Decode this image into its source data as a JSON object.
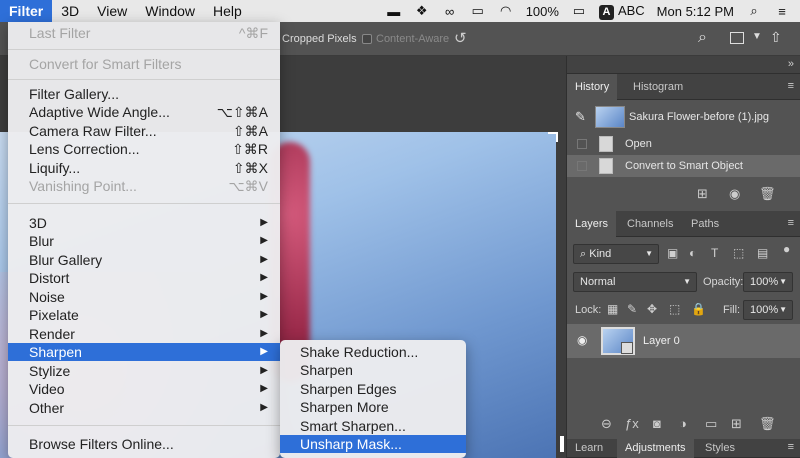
{
  "menubar": {
    "items": [
      "Filter",
      "3D",
      "View",
      "Window",
      "Help"
    ],
    "active_index": 0,
    "battery": "100%",
    "input_source": "ABC",
    "input_badge": "A",
    "clock": "Mon 5:12 PM",
    "status_icons": [
      "dropbox-icon",
      "creative-cloud-icon",
      "airplay-icon",
      "wifi-icon",
      "battery-icon",
      "search-icon",
      "control-center-icon"
    ]
  },
  "optionsbar": {
    "cropped_pixels": "Cropped Pixels",
    "content_aware": "Content-Aware"
  },
  "filter_menu": {
    "last_filter": {
      "label": "Last Filter",
      "shortcut": "^⌘F",
      "disabled": true
    },
    "convert_smart": {
      "label": "Convert for Smart Filters",
      "disabled": true
    },
    "group1": [
      {
        "label": "Filter Gallery...",
        "shortcut": ""
      },
      {
        "label": "Adaptive Wide Angle...",
        "shortcut": "⌥⇧⌘A"
      },
      {
        "label": "Camera Raw Filter...",
        "shortcut": "⇧⌘A"
      },
      {
        "label": "Lens Correction...",
        "shortcut": "⇧⌘R"
      },
      {
        "label": "Liquify...",
        "shortcut": "⇧⌘X"
      },
      {
        "label": "Vanishing Point...",
        "shortcut": "⌥⌘V",
        "disabled": true
      }
    ],
    "group2": [
      "3D",
      "Blur",
      "Blur Gallery",
      "Distort",
      "Noise",
      "Pixelate",
      "Render",
      "Sharpen",
      "Stylize",
      "Video",
      "Other"
    ],
    "highlighted": "Sharpen",
    "browse": "Browse Filters Online..."
  },
  "sharpen_submenu": {
    "items": [
      "Shake Reduction...",
      "Sharpen",
      "Sharpen Edges",
      "Sharpen More",
      "Smart Sharpen...",
      "Unsharp Mask..."
    ],
    "highlighted": "Unsharp Mask..."
  },
  "history_panel": {
    "tabs": [
      "History",
      "Histogram"
    ],
    "active_tab": "History",
    "snapshot": "Sakura Flower-before (1).jpg",
    "states": [
      "Open",
      "Convert to Smart Object"
    ]
  },
  "layers_panel": {
    "tabs": [
      "Layers",
      "Channels",
      "Paths"
    ],
    "active_tab": "Layers",
    "filter_kind": "Kind",
    "blend_mode": "Normal",
    "opacity_label": "Opacity:",
    "opacity_value": "100%",
    "lock_label": "Lock:",
    "fill_label": "Fill:",
    "fill_value": "100%",
    "layers": [
      {
        "name": "Layer 0"
      }
    ]
  },
  "bottom_tabs": {
    "tabs": [
      "Learn",
      "Adjustments",
      "Styles"
    ],
    "active_tab": "Adjustments"
  },
  "colors": {
    "menu_highlight": "#2e6fd8",
    "panel_bg": "#535353",
    "panel_tab_bg": "#424242",
    "selected_row": "#6a6a6a"
  }
}
